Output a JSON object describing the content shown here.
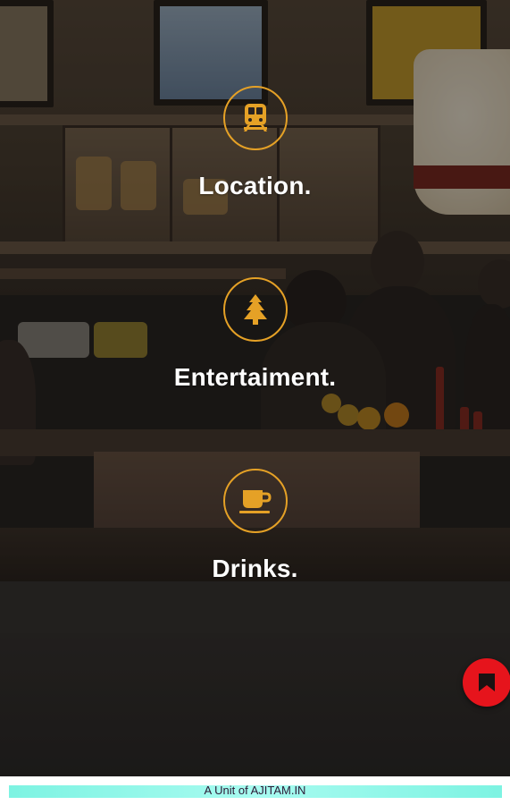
{
  "colors": {
    "accent": "#e5a126",
    "fab": "#e6141c",
    "footer_bar": "#7df3e2",
    "label": "#ffffff"
  },
  "features": [
    {
      "icon": "train-icon",
      "label": "Location."
    },
    {
      "icon": "tree-icon",
      "label": "Entertaiment."
    },
    {
      "icon": "coffee-cup-icon",
      "label": "Drinks."
    }
  ],
  "fab": {
    "icon": "bookmark-icon"
  },
  "footer": {
    "text": "A Unit of AJITAM.IN"
  }
}
